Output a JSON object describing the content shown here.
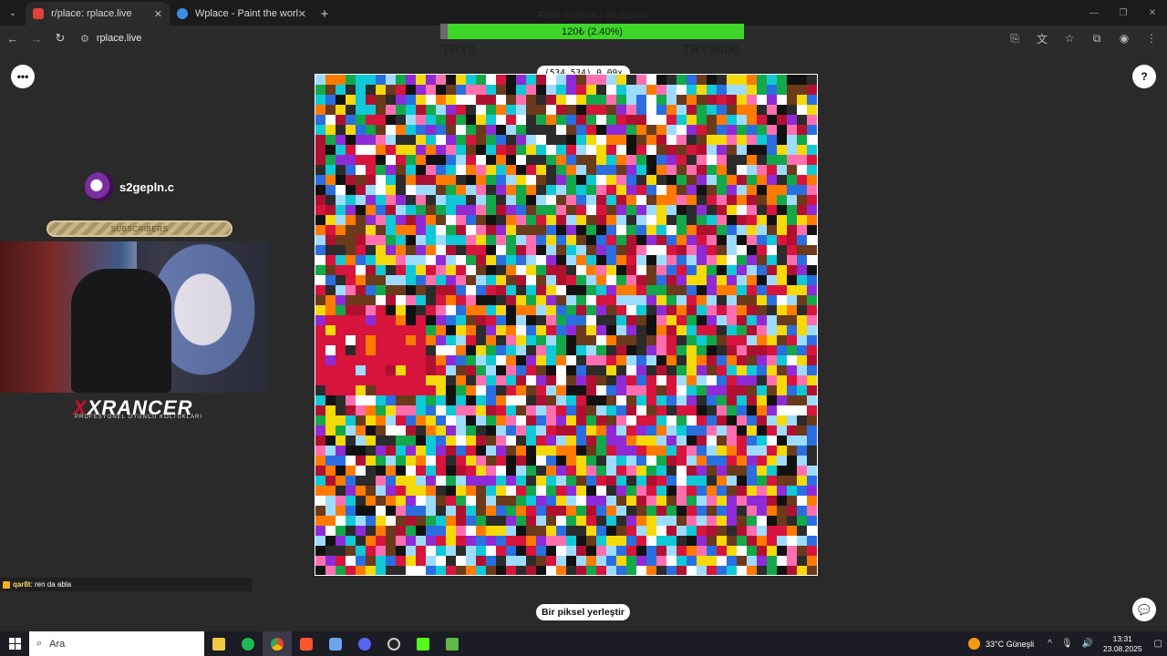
{
  "browser": {
    "tabs": [
      {
        "title": "r/place: rplace.live",
        "favicon_color": "#e0413a",
        "active": true
      },
      {
        "title": "Wplace - Paint the world",
        "favicon_color": "#3a8fe0",
        "active": false
      }
    ],
    "url": "rplace.live"
  },
  "overlay": {
    "title": "Fiber internet / Pc bakım",
    "donation_text": "120₺ (2.40%)",
    "progress_fraction": 0.024,
    "goal_min": "TRY0",
    "goal_max": "TRY5000"
  },
  "canvas": {
    "coordinates": "(534,534) 0.09x",
    "place_button": "Bir piksel yerleştir"
  },
  "stream": {
    "streamer_name": "s2gepln.c",
    "subscribers_label": "SUBSCRIBERS",
    "brand_name": "XRANCER",
    "brand_tagline": "PROFESYONEL OYUNCU KOLTUKLARI",
    "chat_user": "qar8t",
    "chat_message": ": ren da abla"
  },
  "taskbar": {
    "search_placeholder": "Ara",
    "weather": "33°C  Güneşli",
    "time": "13:31",
    "date": "23.08.2025"
  },
  "colors": {
    "accent_green": "#3fd62a",
    "brand_red": "#c8102e"
  }
}
